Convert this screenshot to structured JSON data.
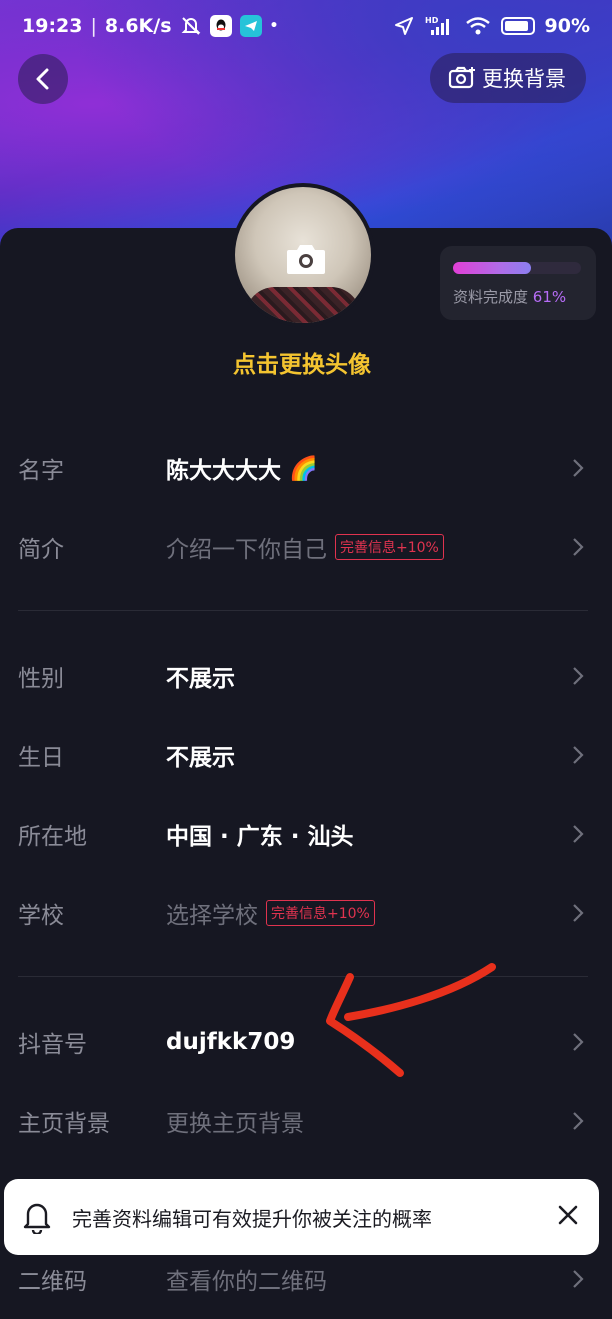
{
  "status_bar": {
    "time": "19:23",
    "network_speed": "8.6K/s",
    "battery": "90%",
    "battery_level": 0.9,
    "icons": [
      "bell-muted-icon",
      "qq-icon",
      "telegram-icon",
      "location-icon",
      "hd-signal-icon",
      "wifi-icon",
      "battery-icon"
    ]
  },
  "header": {
    "change_background": "更换背景"
  },
  "avatar": {
    "change_label": "点击更换头像"
  },
  "completion": {
    "label": "资料完成度",
    "percent_text": "61%",
    "percent": 61
  },
  "rows": [
    {
      "label": "名字",
      "value": "陈大大大大",
      "emoji": "🌈"
    },
    {
      "label": "简介",
      "value": "介绍一下你自己",
      "tag": "完善信息+10%"
    },
    {
      "label": "性别",
      "value": "不展示"
    },
    {
      "label": "生日",
      "value": "不展示"
    },
    {
      "label": "所在地",
      "value": "中国 · 广东 · 汕头"
    },
    {
      "label": "学校",
      "value": "选择学校",
      "tag": "完善信息+10%"
    },
    {
      "label": "抖音号",
      "value": "dujfkk709"
    },
    {
      "label": "主页背景",
      "value": "更换主页背景"
    },
    {
      "label": "二维码",
      "value": "查看你的二维码"
    }
  ],
  "toast": {
    "message": "完善资料编辑可有效提升你被关注的概率"
  },
  "colors": {
    "accent_yellow": "#f4c430",
    "tag_red": "#e0334f",
    "annotation_arrow": "#e8301c",
    "background": "#161722"
  }
}
